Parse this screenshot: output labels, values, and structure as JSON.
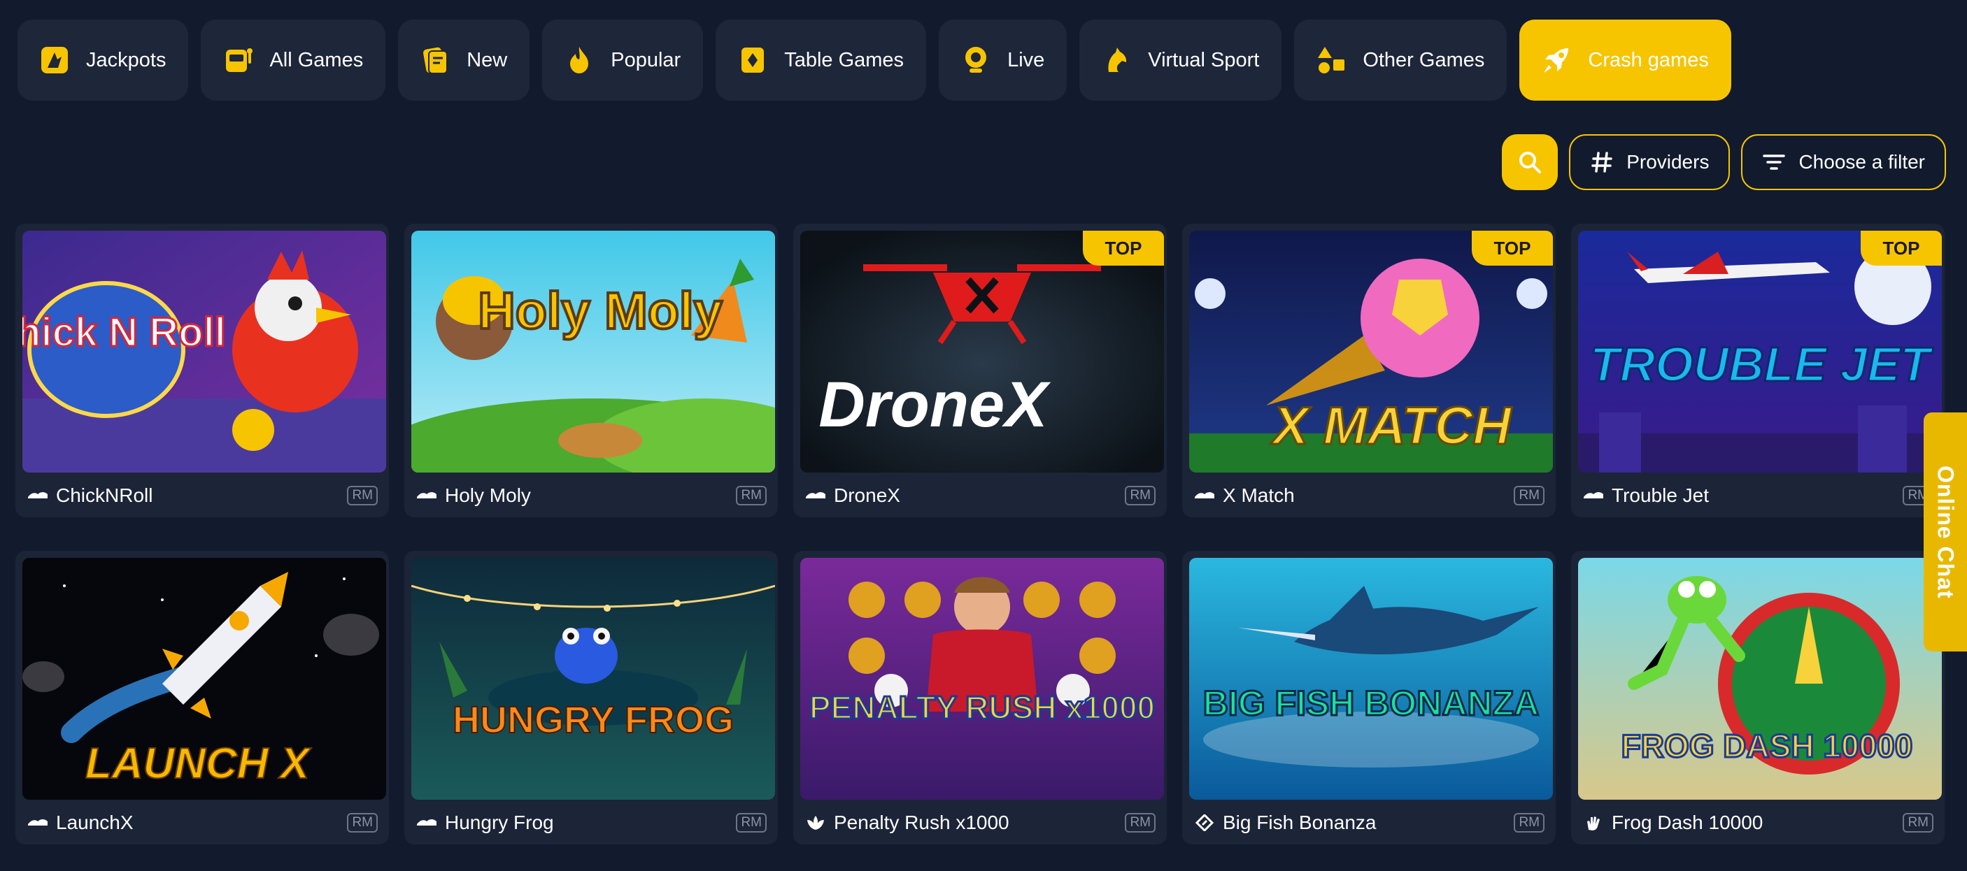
{
  "tabs": [
    {
      "label": "Jackpots",
      "icon": "jackpots-icon"
    },
    {
      "label": "All Games",
      "icon": "slot-machine-icon"
    },
    {
      "label": "New",
      "icon": "new-cards-icon"
    },
    {
      "label": "Popular",
      "icon": "flame-icon"
    },
    {
      "label": "Table Games",
      "icon": "diamond-card-icon"
    },
    {
      "label": "Live",
      "icon": "webcam-icon"
    },
    {
      "label": "Virtual Sport",
      "icon": "horse-icon"
    },
    {
      "label": "Other Games",
      "icon": "shapes-icon"
    },
    {
      "label": "Crash games",
      "icon": "rocket-icon",
      "active": true
    }
  ],
  "filters": {
    "search_icon": "search-icon",
    "providers_label": "Providers",
    "filter_label": "Choose a filter"
  },
  "games": [
    {
      "name": "ChickNRoll",
      "badge": "RM",
      "provider_icon": "provider-wave-icon",
      "thumb_title": "Chick N Roll"
    },
    {
      "name": "Holy Moly",
      "badge": "RM",
      "provider_icon": "provider-wave-icon",
      "thumb_title": "Holy Moly"
    },
    {
      "name": "DroneX",
      "badge": "RM",
      "provider_icon": "provider-wave-icon",
      "top": "TOP",
      "thumb_title": "DroneX"
    },
    {
      "name": "X Match",
      "badge": "RM",
      "provider_icon": "provider-wave-icon",
      "top": "TOP",
      "thumb_title": "X MATCH"
    },
    {
      "name": "Trouble Jet",
      "badge": "RM",
      "provider_icon": "provider-wave-icon",
      "top": "TOP",
      "thumb_title": "TROUBLE JET"
    },
    {
      "name": "LaunchX",
      "badge": "RM",
      "provider_icon": "provider-wave-icon",
      "thumb_title": "LAUNCH X"
    },
    {
      "name": "Hungry Frog",
      "badge": "RM",
      "provider_icon": "provider-wave-icon",
      "thumb_title": "HUNGRY FROG"
    },
    {
      "name": "Penalty Rush x1000",
      "badge": "RM",
      "provider_icon": "provider-flower-icon",
      "thumb_title": "PENALTY RUSH x1000"
    },
    {
      "name": "Big Fish Bonanza",
      "badge": "RM",
      "provider_icon": "provider-diamond-icon",
      "thumb_title": "BIG FISH BONANZA"
    },
    {
      "name": "Frog Dash 10000",
      "badge": "RM",
      "provider_icon": "provider-hand-icon",
      "thumb_title": "FROG DASH 10000"
    }
  ],
  "chat": {
    "label": "Online Chat"
  },
  "colors": {
    "accent": "#f7c400",
    "background": "#121a2e",
    "tab_bg": "#1e263a",
    "card_bg": "#1c2438"
  }
}
